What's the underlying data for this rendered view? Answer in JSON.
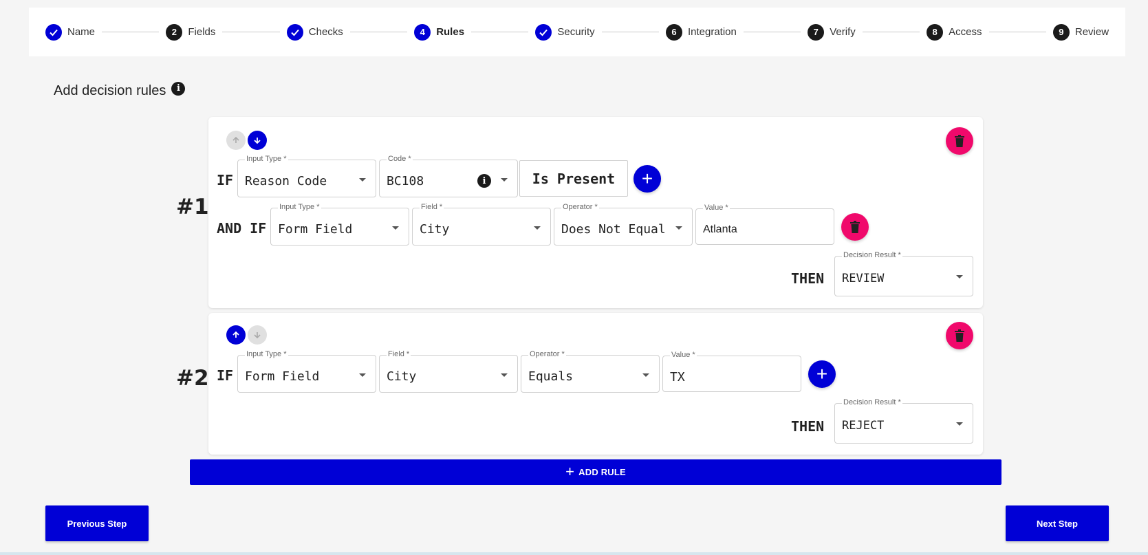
{
  "stepper": {
    "steps": [
      {
        "number": "1",
        "label": "Name",
        "state": "done"
      },
      {
        "number": "2",
        "label": "Fields",
        "state": "pending"
      },
      {
        "number": "3",
        "label": "Checks",
        "state": "done"
      },
      {
        "number": "4",
        "label": "Rules",
        "state": "active"
      },
      {
        "number": "5",
        "label": "Security",
        "state": "done"
      },
      {
        "number": "6",
        "label": "Integration",
        "state": "pending"
      },
      {
        "number": "7",
        "label": "Verify",
        "state": "pending"
      },
      {
        "number": "8",
        "label": "Access",
        "state": "pending"
      },
      {
        "number": "9",
        "label": "Review",
        "state": "pending"
      }
    ]
  },
  "page": {
    "title": "Add decision rules",
    "info_icon": "i"
  },
  "rules": [
    {
      "number": "#1",
      "conditions": [
        {
          "keyword": "IF",
          "input_type": {
            "label": "Input Type *",
            "value": "Reason Code"
          },
          "code": {
            "label": "Code *",
            "value": "BC108"
          },
          "operator_text": "Is Present"
        },
        {
          "keyword": "AND IF",
          "input_type": {
            "label": "Input Type *",
            "value": "Form Field"
          },
          "field": {
            "label": "Field *",
            "value": "City"
          },
          "operator": {
            "label": "Operator *",
            "value": "Does Not Equal"
          },
          "value": {
            "label": "Value *",
            "value": "Atlanta"
          }
        }
      ],
      "then_keyword": "THEN",
      "decision": {
        "label": "Decision Result *",
        "value": "REVIEW"
      }
    },
    {
      "number": "#2",
      "conditions": [
        {
          "keyword": "IF",
          "input_type": {
            "label": "Input Type *",
            "value": "Form Field"
          },
          "field": {
            "label": "Field *",
            "value": "City"
          },
          "operator": {
            "label": "Operator *",
            "value": "Equals"
          },
          "value": {
            "label": "Value *",
            "value": "TX"
          }
        }
      ],
      "then_keyword": "THEN",
      "decision": {
        "label": "Decision Result *",
        "value": "REJECT"
      }
    }
  ],
  "actions": {
    "add_rule": "ADD RULE",
    "add_rule_icon": "+",
    "add_condition_icon": "+",
    "previous": "Previous Step",
    "next": "Next Step"
  },
  "colors": {
    "primary": "#0000d6",
    "danger": "#f0096b",
    "step_pending": "#1a1a1a"
  }
}
